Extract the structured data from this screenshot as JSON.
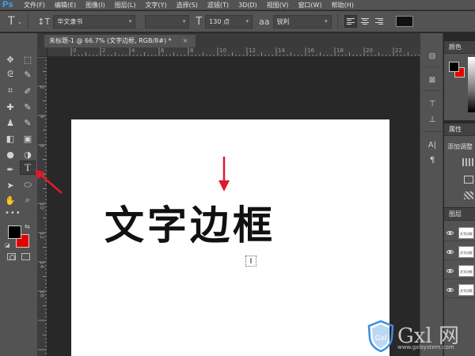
{
  "app": {
    "logo": "Ps"
  },
  "menu": [
    "文件(F)",
    "编辑(E)",
    "图像(I)",
    "图层(L)",
    "文字(Y)",
    "选择(S)",
    "滤镜(T)",
    "3D(D)",
    "视图(V)",
    "窗口(W)",
    "帮助(H)"
  ],
  "options": {
    "tool_icon": "T",
    "orient_icon": "↕T",
    "font_family": "华文隶书",
    "font_style": "",
    "size_icon": "T",
    "font_size": "130 点",
    "aa_icon": "aa",
    "anti_alias": "锐利",
    "text_color": "#111111"
  },
  "document": {
    "tab_title": "未标题-1 @ 66.7% (文字边框, RGB/8#) *",
    "close_glyph": "×",
    "canvas_text": "文字边框"
  },
  "ruler": {
    "top_ticks": [
      "0",
      "2",
      "4",
      "6",
      "8",
      "10",
      "12",
      "14",
      "16",
      "18",
      "20",
      "22"
    ],
    "left_ticks": [
      "2",
      "4",
      "6",
      "8",
      "10",
      "12",
      "14",
      "16"
    ]
  },
  "tools": {
    "move": "✥",
    "marquee": "⬚",
    "lasso": "ᘓ",
    "magic": "✎",
    "crop": "⌗",
    "eyedrop": "✐",
    "heal": "✚",
    "brush": "✎",
    "stamp": "♟",
    "history": "✎",
    "eraser": "◧",
    "gradient": "▣",
    "blur": "●",
    "dodge": "◑",
    "pen": "✒",
    "type": "T",
    "path": "➤",
    "shape": "⬭",
    "hand": "✋",
    "zoom": "⌕",
    "more": "•••"
  },
  "colors": {
    "foreground": "#000000",
    "background": "#e50000",
    "accent": "#e0192a"
  },
  "panels": {
    "color_title": "颜色",
    "props_title": "属性",
    "props_text": "添加调整",
    "layers_title": "图层",
    "layer_thumb_text": "文字边框"
  },
  "rstrip": {
    "a": "⊟",
    "b": "⊠",
    "c": "⊤",
    "d": "⊥",
    "e": "A|",
    "f": "¶"
  },
  "watermark": {
    "brand": "Gxl 网",
    "url": "www.gxlsystem.com",
    "shield_text": "Gxl"
  }
}
